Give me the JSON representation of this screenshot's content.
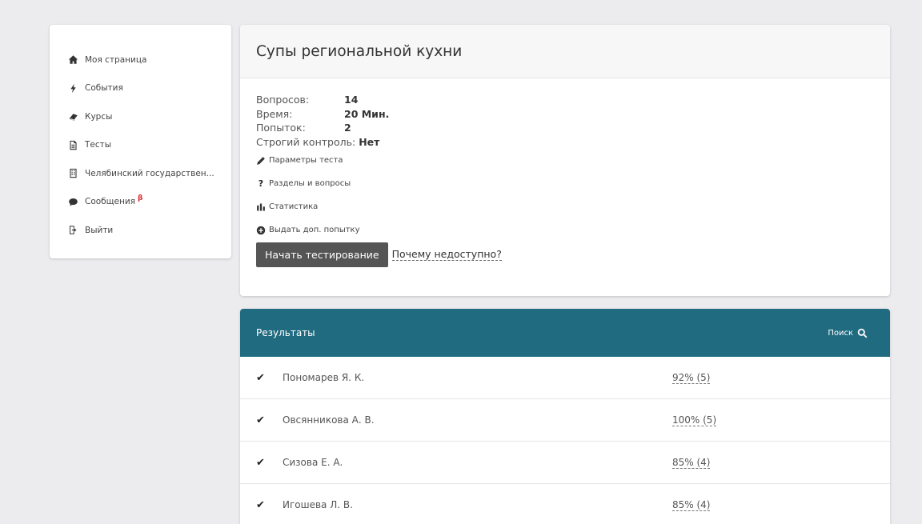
{
  "sidebar": {
    "items": [
      {
        "label": "Моя страница",
        "icon": "home-icon"
      },
      {
        "label": "События",
        "icon": "bolt-icon"
      },
      {
        "label": "Курсы",
        "icon": "book-icon"
      },
      {
        "label": "Тесты",
        "icon": "document-icon"
      },
      {
        "label": "Челябинский государствен...",
        "icon": "building-icon"
      },
      {
        "label": "Сообщения",
        "icon": "chat-icon",
        "badge": "β"
      },
      {
        "label": "Выйти",
        "icon": "logout-icon"
      }
    ]
  },
  "test": {
    "title": "Супы региональной кухни",
    "info": [
      {
        "label": "Вопросов:",
        "value": "14"
      },
      {
        "label": "Время:",
        "value": "20 Мин."
      },
      {
        "label": "Попыток:",
        "value": "2"
      },
      {
        "label": "Строгий контроль:",
        "value": "Нет"
      }
    ],
    "actions": [
      {
        "label": "Параметры теста",
        "icon": "pencil-icon"
      },
      {
        "label": "Разделы и вопросы",
        "icon": "question-icon"
      },
      {
        "label": "Статистика",
        "icon": "bar-chart-icon"
      },
      {
        "label": "Выдать доп. попытку",
        "icon": "plus-circle-icon"
      }
    ],
    "start_label": "Начать тестирование",
    "why_label": "Почему недоступно?"
  },
  "results": {
    "title": "Результаты",
    "search_label": "Поиск",
    "rows": [
      {
        "name": "Пономарев Я. К.",
        "score": "92% (5)"
      },
      {
        "name": "Овсянникова А. В.",
        "score": "100% (5)"
      },
      {
        "name": "Сизова Е. А.",
        "score": "85% (4)"
      },
      {
        "name": "Игошева Л. В.",
        "score": "85% (4)"
      }
    ]
  },
  "colors": {
    "accent": "#216b80",
    "button": "#555555",
    "background": "#ececee",
    "beta": "#d9262b"
  }
}
